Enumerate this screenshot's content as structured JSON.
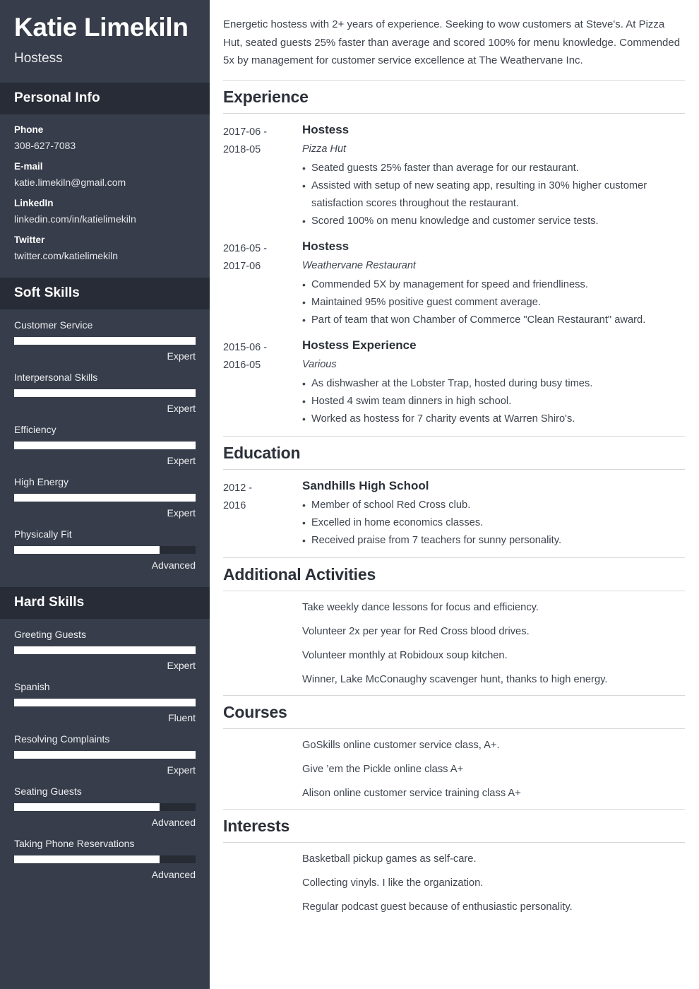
{
  "sidebar": {
    "name": "Katie Limekiln",
    "job_title": "Hostess",
    "personal_info": {
      "heading": "Personal Info",
      "items": [
        {
          "label": "Phone",
          "value": "308-627-7083"
        },
        {
          "label": "E-mail",
          "value": "katie.limekiln@gmail.com"
        },
        {
          "label": "LinkedIn",
          "value": "linkedin.com/in/katielimekiln"
        },
        {
          "label": "Twitter",
          "value": "twitter.com/katielimekiln"
        }
      ]
    },
    "soft_skills": {
      "heading": "Soft Skills",
      "items": [
        {
          "name": "Customer Service",
          "level": "Expert",
          "percent": 100
        },
        {
          "name": "Interpersonal Skills",
          "level": "Expert",
          "percent": 100
        },
        {
          "name": "Efficiency",
          "level": "Expert",
          "percent": 100
        },
        {
          "name": "High Energy",
          "level": "Expert",
          "percent": 100
        },
        {
          "name": "Physically Fit",
          "level": "Advanced",
          "percent": 80
        }
      ]
    },
    "hard_skills": {
      "heading": "Hard Skills",
      "items": [
        {
          "name": "Greeting Guests",
          "level": "Expert",
          "percent": 100
        },
        {
          "name": "Spanish",
          "level": "Fluent",
          "percent": 100
        },
        {
          "name": "Resolving Complaints",
          "level": "Expert",
          "percent": 100
        },
        {
          "name": "Seating Guests",
          "level": "Advanced",
          "percent": 80
        },
        {
          "name": "Taking Phone Reservations",
          "level": "Advanced",
          "percent": 80
        }
      ]
    }
  },
  "main": {
    "summary": "Energetic hostess with 2+ years of experience. Seeking to wow customers at Steve's. At Pizza Hut, seated guests 25% faster than average and scored 100% for menu knowledge. Commended 5x by management for customer service excellence at The Weathervane Inc.",
    "experience": {
      "heading": "Experience",
      "entries": [
        {
          "date": "2017-06 - 2018-05",
          "title": "Hostess",
          "subtitle": "Pizza Hut",
          "bullets": [
            "Seated guests 25% faster than average for our restaurant.",
            "Assisted with setup of new seating app, resulting in 30% higher customer satisfaction scores throughout the restaurant.",
            "Scored 100% on menu knowledge and customer service tests."
          ]
        },
        {
          "date": "2016-05 - 2017-06",
          "title": "Hostess",
          "subtitle": "Weathervane Restaurant",
          "bullets": [
            "Commended 5X by management for speed and friendliness.",
            "Maintained 95% positive guest comment average.",
            "Part of team that won Chamber of Commerce \"Clean Restaurant\" award."
          ]
        },
        {
          "date": "2015-06 - 2016-05",
          "title": "Hostess Experience",
          "subtitle": "Various",
          "bullets": [
            "As dishwasher at the Lobster Trap, hosted during busy times.",
            "Hosted 4 swim team dinners in high school.",
            "Worked as hostess for 7 charity events at Warren Shiro's."
          ]
        }
      ]
    },
    "education": {
      "heading": "Education",
      "entries": [
        {
          "date": "2012 - 2016",
          "title": "Sandhills High School",
          "subtitle": "",
          "bullets": [
            "Member of school Red Cross club.",
            "Excelled in home economics classes.",
            "Received praise from 7 teachers for sunny personality."
          ]
        }
      ]
    },
    "additional_activities": {
      "heading": "Additional Activities",
      "items": [
        "Take weekly dance lessons for focus and efficiency.",
        "Volunteer 2x per year for Red Cross blood drives.",
        "Volunteer monthly at Robidoux soup kitchen.",
        "Winner, Lake McConaughy scavenger hunt, thanks to high energy."
      ]
    },
    "courses": {
      "heading": "Courses",
      "items": [
        "GoSkills online customer service class, A+.",
        "Give ’em the Pickle online class A+",
        "Alison online customer service training class A+"
      ]
    },
    "interests": {
      "heading": "Interests",
      "items": [
        "Basketball pickup games as self-care.",
        "Collecting vinyls. I like the organization.",
        "Regular podcast guest because of enthusiastic personality."
      ]
    }
  },
  "colors": {
    "sidebar_bg": "#373d4a",
    "sidebar_header_bg": "#272c36",
    "bar_fill": "#ffffff",
    "bar_track": "#262b34",
    "text_dark": "#3f444f"
  }
}
